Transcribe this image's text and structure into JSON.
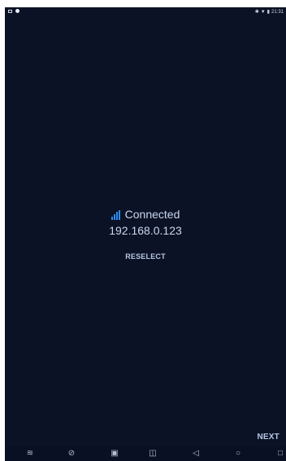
{
  "status": {
    "time": "21:31"
  },
  "connection": {
    "status": "Connected",
    "ip_address": "192.168.0.123"
  },
  "actions": {
    "reselect_label": "RESELECT",
    "next_label": "NEXT"
  },
  "icons": {
    "signal": "signal-strength-icon",
    "nav_system": "settings-icon",
    "nav_no": "block-icon",
    "nav_screenshot": "screenshot-icon",
    "nav_volume": "volume-icon",
    "nav_back": "back-icon",
    "nav_home": "home-icon",
    "nav_recents": "recents-icon"
  },
  "colors": {
    "background": "#0b1226",
    "accent": "#2f8cf2",
    "text": "#c9d6ee"
  }
}
